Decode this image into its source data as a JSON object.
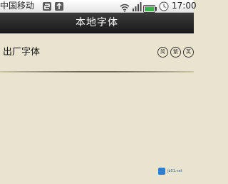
{
  "status_bar": {
    "carrier": "中国移动",
    "time": "17:00",
    "icons": [
      "usb-debug-icon",
      "usb-connected-icon",
      "wifi-icon",
      "signal-icon",
      "battery-icon",
      "clock-icon"
    ]
  },
  "header": {
    "title": "本地字体"
  },
  "font_list": {
    "items": [
      {
        "name": "出厂字体",
        "badges": [
          "简",
          "繁",
          "英"
        ]
      }
    ]
  },
  "watermark": {
    "text": "jb51.net"
  },
  "colors": {
    "background": "#e9e4cf",
    "title_bar": "#262626",
    "title_text": "#ffffff",
    "watermark_blue": "#2f7fd1"
  }
}
